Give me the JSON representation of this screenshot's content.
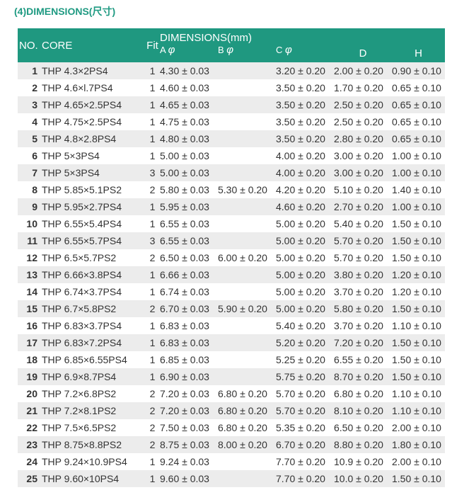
{
  "title": "(4)DIMENSIONS(尺寸)",
  "header": {
    "no": "NO.",
    "core": "CORE",
    "fit": "Fit",
    "dimensions": "DIMENSIONS(mm)",
    "a": "A",
    "b": "B",
    "c": "C",
    "phi": "φ",
    "d": "D",
    "h": "H"
  },
  "rows": [
    {
      "no": "1",
      "core": "THP 4.3×2PS4",
      "fit": "1",
      "a": "4.30 ± 0.03",
      "b": "",
      "c": "3.20 ± 0.20",
      "d": "2.00 ± 0.20",
      "h": "0.90 ± 0.10"
    },
    {
      "no": "2",
      "core": "THP 4.6×l.7PS4",
      "fit": "1",
      "a": "4.60 ± 0.03",
      "b": "",
      "c": "3.50 ± 0.20",
      "d": "1.70 ± 0.20",
      "h": "0.65 ± 0.10"
    },
    {
      "no": "3",
      "core": "THP 4.65×2.5PS4",
      "fit": "1",
      "a": "4.65 ± 0.03",
      "b": "",
      "c": "3.50 ± 0.20",
      "d": "2.50 ± 0.20",
      "h": "0.65 ± 0.10"
    },
    {
      "no": "4",
      "core": "THP 4.75×2.5PS4",
      "fit": "1",
      "a": "4.75 ± 0.03",
      "b": "",
      "c": "3.50 ± 0.20",
      "d": "2.50 ± 0.20",
      "h": "0.65 ± 0.10"
    },
    {
      "no": "5",
      "core": "THP 4.8×2.8PS4",
      "fit": "1",
      "a": "4.80 ± 0.03",
      "b": "",
      "c": "3.50 ± 0.20",
      "d": "2.80 ± 0.20",
      "h": "0.65 ± 0.10"
    },
    {
      "no": "6",
      "core": "THP 5×3PS4",
      "fit": "1",
      "a": "5.00 ± 0.03",
      "b": "",
      "c": "4.00 ± 0.20",
      "d": "3.00 ± 0.20",
      "h": "1.00 ± 0.10"
    },
    {
      "no": "7",
      "core": "THP 5×3PS4",
      "fit": "3",
      "a": "5.00 ± 0.03",
      "b": "",
      "c": "4.00 ± 0.20",
      "d": "3.00 ± 0.20",
      "h": "1.00 ± 0.10"
    },
    {
      "no": "8",
      "core": "THP 5.85×5.1PS2",
      "fit": "2",
      "a": "5.80 ± 0.03",
      "b": "5.30 ± 0.20",
      "c": "4.20 ± 0.20",
      "d": "5.10 ± 0.20",
      "h": "1.40 ± 0.10"
    },
    {
      "no": "9",
      "core": "THP 5.95×2.7PS4",
      "fit": "1",
      "a": "5.95 ± 0.03",
      "b": "",
      "c": "4.60 ± 0.20",
      "d": "2.70 ± 0.20",
      "h": "1.00 ± 0.10"
    },
    {
      "no": "10",
      "core": "THP 6.55×5.4PS4",
      "fit": "1",
      "a": "6.55 ± 0.03",
      "b": "",
      "c": "5.00 ± 0.20",
      "d": "5.40 ± 0.20",
      "h": "1.50 ± 0.10"
    },
    {
      "no": "11",
      "core": "THP 6.55×5.7PS4",
      "fit": "3",
      "a": "6.55 ± 0.03",
      "b": "",
      "c": "5.00 ± 0.20",
      "d": "5.70 ± 0.20",
      "h": "1.50 ± 0.10"
    },
    {
      "no": "12",
      "core": "THP 6.5×5.7PS2",
      "fit": "2",
      "a": "6.50 ± 0.03",
      "b": "6.00 ± 0.20",
      "c": "5.00 ± 0.20",
      "d": "5.70 ± 0.20",
      "h": "1.50 ± 0.10"
    },
    {
      "no": "13",
      "core": "THP 6.66×3.8PS4",
      "fit": "1",
      "a": "6.66 ± 0.03",
      "b": "",
      "c": "5.00 ± 0.20",
      "d": "3.80 ± 0.20",
      "h": "1.20 ± 0.10"
    },
    {
      "no": "14",
      "core": "THP 6.74×3.7PS4",
      "fit": "1",
      "a": "6.74 ± 0.03",
      "b": "",
      "c": "5.00 ± 0.20",
      "d": "3.70 ± 0.20",
      "h": "1.20 ± 0.10"
    },
    {
      "no": "15",
      "core": "THP 6.7×5.8PS2",
      "fit": "2",
      "a": "6.70 ± 0.03",
      "b": "5.90 ± 0.20",
      "c": "5.00 ± 0.20",
      "d": "5.80 ± 0.20",
      "h": "1.50 ± 0.10"
    },
    {
      "no": "16",
      "core": "THP 6.83×3.7PS4",
      "fit": "1",
      "a": "6.83 ± 0.03",
      "b": "",
      "c": "5.40 ± 0.20",
      "d": "3.70 ± 0.20",
      "h": "1.10 ± 0.10"
    },
    {
      "no": "17",
      "core": "THP 6.83×7.2PS4",
      "fit": "1",
      "a": "6.83 ± 0.03",
      "b": "",
      "c": "5.20 ± 0.20",
      "d": "7.20 ± 0.20",
      "h": "1.50 ± 0.10"
    },
    {
      "no": "18",
      "core": "THP 6.85×6.55PS4",
      "fit": "1",
      "a": "6.85 ± 0.03",
      "b": "",
      "c": "5.25 ± 0.20",
      "d": "6.55 ± 0.20",
      "h": "1.50 ± 0.10"
    },
    {
      "no": "19",
      "core": "THP 6.9×8.7PS4",
      "fit": "1",
      "a": "6.90 ± 0.03",
      "b": "",
      "c": "5.75 ± 0.20",
      "d": "8.70 ± 0.20",
      "h": "1.50 ± 0.10"
    },
    {
      "no": "20",
      "core": "THP 7.2×6.8PS2",
      "fit": "2",
      "a": "7.20 ± 0.03",
      "b": "6.80 ± 0.20",
      "c": "5.70 ± 0.20",
      "d": "6.80 ± 0.20",
      "h": "1.10 ± 0.10"
    },
    {
      "no": "21",
      "core": "THP 7.2×8.1PS2",
      "fit": "2",
      "a": "7.20 ± 0.03",
      "b": "6.80 ± 0.20",
      "c": "5.70 ± 0.20",
      "d": "8.10 ± 0.20",
      "h": "1.10 ± 0.10"
    },
    {
      "no": "22",
      "core": "THP 7.5×6.5PS2",
      "fit": "2",
      "a": "7.50 ± 0.03",
      "b": "6.80 ± 0.20",
      "c": "5.35 ± 0.20",
      "d": "6.50 ± 0.20",
      "h": "2.00 ± 0.10"
    },
    {
      "no": "23",
      "core": "THP 8.75×8.8PS2",
      "fit": "2",
      "a": "8.75 ± 0.03",
      "b": "8.00 ± 0.20",
      "c": "6.70 ± 0.20",
      "d": "8.80 ± 0.20",
      "h": "1.80 ± 0.10"
    },
    {
      "no": "24",
      "core": "THP 9.24×10.9PS4",
      "fit": "1",
      "a": "9.24 ± 0.03",
      "b": "",
      "c": "7.70 ± 0.20",
      "d": "10.9 ± 0.20",
      "h": "2.00 ± 0.10"
    },
    {
      "no": "25",
      "core": "THP 9.60×10PS4",
      "fit": "1",
      "a": "9.60 ± 0.03",
      "b": "",
      "c": "7.70 ± 0.20",
      "d": "10.0 ± 0.20",
      "h": "1.50 ± 0.10"
    }
  ]
}
